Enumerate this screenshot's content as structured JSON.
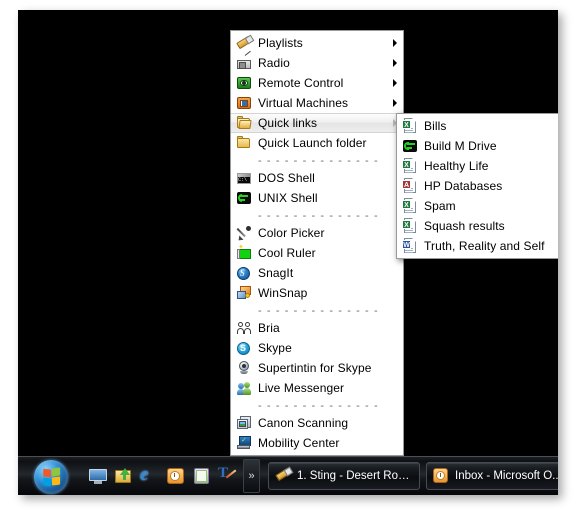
{
  "desktop": {
    "background_color": "#000000"
  },
  "main_menu": {
    "items": [
      {
        "type": "item",
        "label": "Playlists",
        "icon": "playlists-icon",
        "submenu": true,
        "selected": false
      },
      {
        "type": "item",
        "label": "Radio",
        "icon": "radio-icon",
        "submenu": true,
        "selected": false
      },
      {
        "type": "item",
        "label": "Remote Control",
        "icon": "remote-control-icon",
        "submenu": true,
        "selected": false
      },
      {
        "type": "item",
        "label": "Virtual Machines",
        "icon": "virtual-machines-icon",
        "submenu": true,
        "selected": false
      },
      {
        "type": "item",
        "label": "Quick links",
        "icon": "quick-links-folder-icon",
        "submenu": true,
        "selected": true
      },
      {
        "type": "item",
        "label": "Quick Launch folder",
        "icon": "folder-icon",
        "submenu": false,
        "selected": false
      },
      {
        "type": "separator",
        "label": "- - - - - - - - - - - - - -"
      },
      {
        "type": "item",
        "label": "DOS Shell",
        "icon": "dos-shell-icon",
        "submenu": false,
        "selected": false
      },
      {
        "type": "item",
        "label": "UNIX Shell",
        "icon": "unix-shell-icon",
        "submenu": false,
        "selected": false
      },
      {
        "type": "separator",
        "label": "- - - - - - - - - - - - - -"
      },
      {
        "type": "item",
        "label": "Color Picker",
        "icon": "eyedropper-icon",
        "submenu": false,
        "selected": false
      },
      {
        "type": "item",
        "label": "Cool Ruler",
        "icon": "ruler-icon",
        "submenu": false,
        "selected": false
      },
      {
        "type": "item",
        "label": "SnagIt",
        "icon": "snagit-icon",
        "submenu": false,
        "selected": false
      },
      {
        "type": "item",
        "label": "WinSnap",
        "icon": "winsnap-icon",
        "submenu": false,
        "selected": false
      },
      {
        "type": "separator",
        "label": "- - - - - - - - - - - - - -"
      },
      {
        "type": "item",
        "label": "Bria",
        "icon": "bria-people-icon",
        "submenu": false,
        "selected": false
      },
      {
        "type": "item",
        "label": "Skype",
        "icon": "skype-icon",
        "submenu": false,
        "selected": false
      },
      {
        "type": "item",
        "label": "Supertintin for Skype",
        "icon": "webcam-icon",
        "submenu": false,
        "selected": false
      },
      {
        "type": "item",
        "label": "Live Messenger",
        "icon": "live-messenger-icon",
        "submenu": false,
        "selected": false
      },
      {
        "type": "separator",
        "label": "- - - - - - - - - - - - - -"
      },
      {
        "type": "item",
        "label": "Canon Scanning",
        "icon": "scanner-icon",
        "submenu": false,
        "selected": false
      },
      {
        "type": "item",
        "label": "Mobility Center",
        "icon": "mobility-center-icon",
        "submenu": false,
        "selected": false
      }
    ]
  },
  "sub_menu": {
    "parent_label": "Quick links",
    "items": [
      {
        "label": "Bills",
        "icon": "excel-shortcut-icon"
      },
      {
        "label": "Build M Drive",
        "icon": "unix-shell-icon"
      },
      {
        "label": "Healthy Life",
        "icon": "excel-shortcut-icon"
      },
      {
        "label": "HP Databases",
        "icon": "access-shortcut-icon"
      },
      {
        "label": "Spam",
        "icon": "excel-shortcut-icon"
      },
      {
        "label": "Squash results",
        "icon": "excel-shortcut-icon"
      },
      {
        "label": "Truth, Reality and Self",
        "icon": "word-shortcut-icon"
      }
    ]
  },
  "taskbar": {
    "start_button": {
      "label": "Start",
      "icon": "windows-orb-icon"
    },
    "quick_launch": [
      {
        "icon": "show-desktop-icon",
        "label": "Show Desktop"
      },
      {
        "icon": "folder-green-arrow-icon",
        "label": "Folder"
      },
      {
        "icon": "internet-explorer-icon",
        "label": "Internet Explorer"
      },
      {
        "icon": "outlook-icon",
        "label": "Outlook"
      },
      {
        "icon": "notepad-green-icon",
        "label": "Notes"
      },
      {
        "icon": "text-pen-icon",
        "label": "Text Tool"
      }
    ],
    "overflow_label": "»",
    "buttons": [
      {
        "label": "1. Sting - Desert Ros...",
        "icon": "media-player-icon",
        "active": false
      },
      {
        "label": "Inbox - Microsoft O...",
        "icon": "outlook-icon",
        "active": false
      }
    ]
  }
}
